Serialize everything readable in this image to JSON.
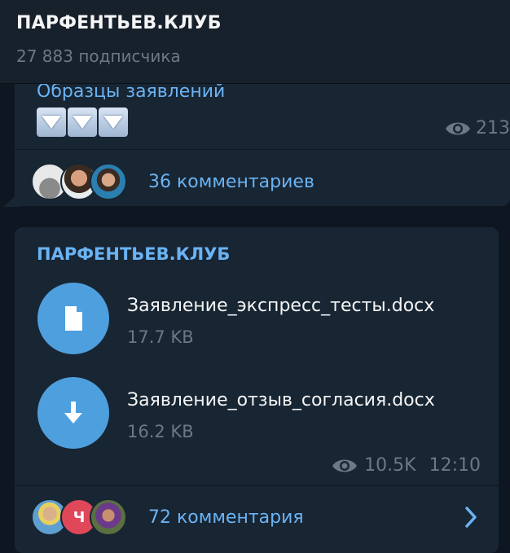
{
  "channel": {
    "title": "ПАРФЕНТЬЕВ.КЛУБ",
    "subscribers": "27 883 подписчика"
  },
  "post1": {
    "link_text": "Образцы заявлений",
    "views": "213",
    "comments_label": "36 комментариев"
  },
  "post2": {
    "author": "ПАРФЕНТЬЕВ.КЛУБ",
    "files": [
      {
        "name": "Заявление_экспресс_тесты.docx",
        "size": "17.7 KB",
        "icon": "document-icon"
      },
      {
        "name": "Заявление_отзыв_согласия.docx",
        "size": "16.2 KB",
        "icon": "download-icon"
      }
    ],
    "views": "10.5K",
    "time": "12:10",
    "comments_label": "72 комментария",
    "avatar_letter": "Ч"
  },
  "colors": {
    "background": "#0e1621",
    "bubble": "#182533",
    "accent": "#6ab3f3",
    "file_icon": "#4e9fdd",
    "muted": "#6c7883"
  }
}
